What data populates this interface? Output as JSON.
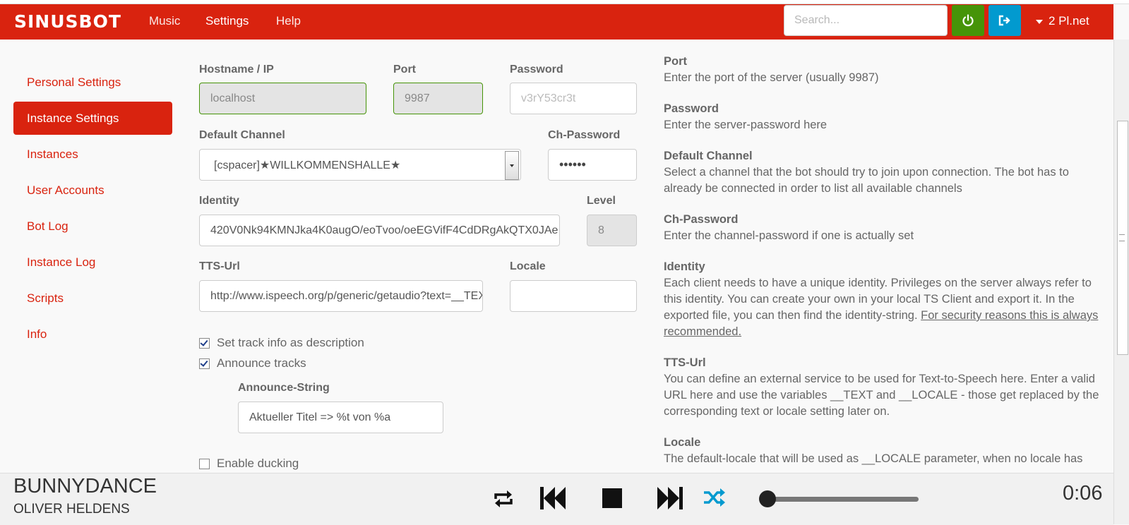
{
  "navbar": {
    "brand": "SINUSBOT",
    "links": [
      "Music",
      "Settings",
      "Help"
    ],
    "search_placeholder": "Search...",
    "user_label": "2 Pl.net"
  },
  "sidebar": {
    "items": [
      {
        "label": "Personal Settings",
        "active": false
      },
      {
        "label": "Instance Settings",
        "active": true
      },
      {
        "label": "Instances",
        "active": false
      },
      {
        "label": "User Accounts",
        "active": false
      },
      {
        "label": "Bot Log",
        "active": false
      },
      {
        "label": "Instance Log",
        "active": false
      },
      {
        "label": "Scripts",
        "active": false
      },
      {
        "label": "Info",
        "active": false
      }
    ]
  },
  "form": {
    "hostname": {
      "label": "Hostname / IP",
      "value": "localhost"
    },
    "port": {
      "label": "Port",
      "value": "9987"
    },
    "password": {
      "label": "Password",
      "placeholder": "v3rY53cr3t"
    },
    "default_channel": {
      "label": "Default Channel",
      "value": "[cspacer]★WILLKOMMENSHALLE★"
    },
    "ch_password": {
      "label": "Ch-Password",
      "value": "••••••"
    },
    "identity": {
      "label": "Identity",
      "value": "420V0Nk94KMNJka4K0augO/eoTvoo/oeEGVifF4CdDRgAkQTX0JAe"
    },
    "level": {
      "label": "Level",
      "value": "8"
    },
    "tts_url": {
      "label": "TTS-Url",
      "value": "http://www.ispeech.org/p/generic/getaudio?text=__TEXT"
    },
    "locale": {
      "label": "Locale",
      "value": ""
    },
    "set_track_info": {
      "label": "Set track info as description",
      "checked": true
    },
    "announce_tracks": {
      "label": "Announce tracks",
      "checked": true
    },
    "announce_string": {
      "label": "Announce-String",
      "value": "Aktueller Titel => %t von %a"
    },
    "enable_ducking": {
      "label": "Enable ducking",
      "checked": false
    }
  },
  "help": {
    "port": {
      "title": "Port",
      "text": "Enter the port of the server (usually 9987)"
    },
    "password": {
      "title": "Password",
      "text": "Enter the server-password here"
    },
    "default_channel": {
      "title": "Default Channel",
      "text": "Select a channel that the bot should try to join upon connection. The bot has to already be connected in order to list all available channels"
    },
    "ch_password": {
      "title": "Ch-Password",
      "text": "Enter the channel-password if one is actually set"
    },
    "identity": {
      "title": "Identity",
      "text": "Each client needs to have a unique identity. Privileges on the server always refer to this identity. You can create your own in your local TS Client and export it. In the exported file, you can then find the identity-string.",
      "link": "For security reasons this is always recommended."
    },
    "tts_url": {
      "title": "TTS-Url",
      "text": "You can define an external service to be used for Text-to-Speech here. Enter a valid URL here and use the variables __TEXT and __LOCALE - those get replaced by the corresponding text or locale setting later on."
    },
    "locale": {
      "title": "Locale",
      "text": "The default-locale that will be used as __LOCALE parameter, when no locale has"
    }
  },
  "player": {
    "title": "BUNNYDANCE",
    "artist": "OLIVER HELDENS",
    "time": "0:06",
    "progress": 0.0
  },
  "colors": {
    "brand": "#d9230f",
    "power": "#469408",
    "logout": "#029acf",
    "shuffle_active": "#029acf"
  }
}
